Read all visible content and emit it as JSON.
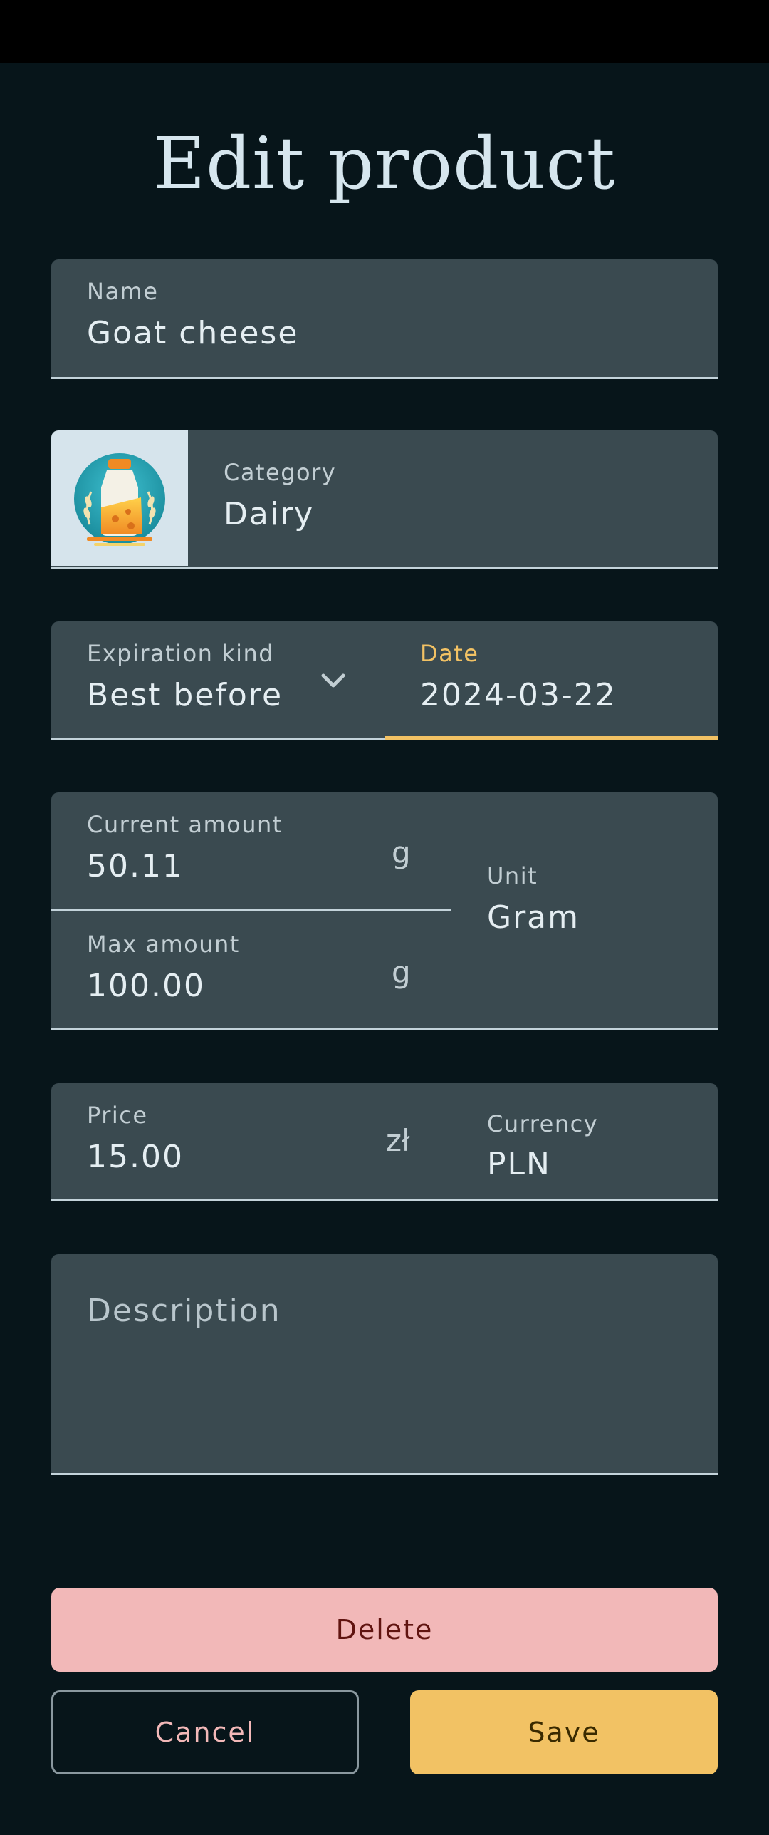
{
  "title": "Edit product",
  "name_field": {
    "label": "Name",
    "value": "Goat cheese"
  },
  "category_field": {
    "label": "Category",
    "value": "Dairy",
    "icon": "dairy-cheese-bottle-icon"
  },
  "expiration": {
    "kind_label": "Expiration kind",
    "kind_value": "Best before",
    "date_label": "Date",
    "date_value": "2024-03-22"
  },
  "amounts": {
    "current_label": "Current amount",
    "current_value": "50.11",
    "current_suffix": "g",
    "max_label": "Max amount",
    "max_value": "100.00",
    "max_suffix": "g",
    "unit_label": "Unit",
    "unit_value": "Gram"
  },
  "price_field": {
    "label": "Price",
    "value": "15.00",
    "suffix": "zł",
    "currency_label": "Currency",
    "currency_value": "PLN"
  },
  "description_field": {
    "placeholder": "Description"
  },
  "buttons": {
    "delete": "Delete",
    "cancel": "Cancel",
    "save": "Save"
  },
  "colors": {
    "background": "#07151a",
    "field": "#3a4a50",
    "accent": "#f2c264",
    "delete": "#f2b8b8",
    "delete_text": "#601410"
  }
}
